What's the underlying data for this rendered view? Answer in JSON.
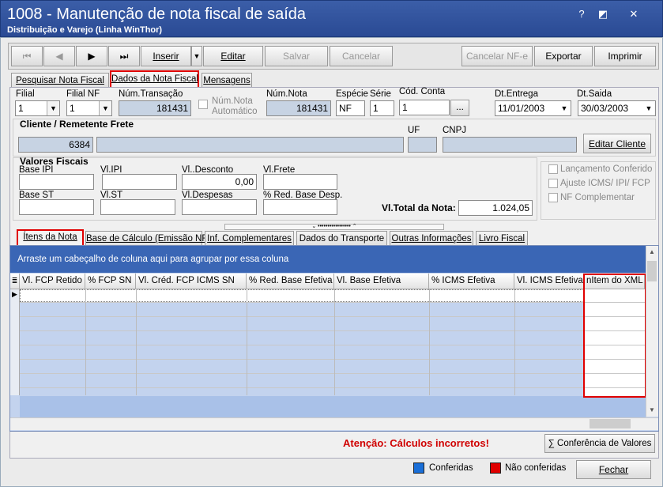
{
  "window": {
    "title": "1008 - Manutenção de nota fiscal de saída",
    "subtitle": "Distribuição e Varejo (Linha WinThor)",
    "buttons": [
      "?",
      "◩",
      "✕"
    ]
  },
  "toolbar": {
    "first": "⏮",
    "prev": "◀",
    "next": "▶",
    "last": "⏭",
    "inserir": "Inserir",
    "editar": "Editar",
    "salvar": "Salvar",
    "cancelar": "Cancelar",
    "cancelar_nfe": "Cancelar NF-e",
    "exportar": "Exportar",
    "imprimir": "Imprimir"
  },
  "tabs": [
    "Pesquisar Nota Fiscal",
    "Dados da Nota Fiscal",
    "Mensagens"
  ],
  "form": {
    "filial_label": "Filial",
    "filial_value": "1",
    "filial_nf_label": "Filial NF",
    "filial_nf_value": "1",
    "num_transacao_label": "Núm.Transação",
    "num_transacao_value": "181431",
    "num_nota_auto_label": "Núm.Nota Automático",
    "num_nota_label": "Núm.Nota",
    "num_nota_value": "181431",
    "especie_label": "Espécie",
    "especie_value": "NF",
    "serie_label": "Série",
    "serie_value": "1",
    "cod_conta_label": "Cód. Conta",
    "cod_conta_value": "1",
    "cod_conta_btn": "...",
    "dt_entrega_label": "Dt.Entrega",
    "dt_entrega_value": "11/01/2003",
    "dt_saida_label": "Dt.Saida",
    "dt_saida_value": "30/03/2003"
  },
  "cliente": {
    "section_label": "Cliente / Remetente Frete",
    "code": "6384",
    "name": "",
    "uf_label": "UF",
    "cnpj_label": "CNPJ",
    "edit_button": "Editar Cliente"
  },
  "valores": {
    "section_label": "Valores Fiscais",
    "base_ipi_label": "Base IPI",
    "base_ipi": "",
    "vl_ipi_label": "Vl.IPI",
    "vl_ipi": "",
    "vl_desconto_label": "Vl..Desconto",
    "vl_desconto": "0,00",
    "vl_frete_label": "Vl.Frete",
    "vl_frete": "",
    "base_st_label": "Base ST",
    "base_st": "",
    "vl_st_label": "Vl.ST",
    "vl_st": "",
    "vl_despesas_label": "Vl.Despesas",
    "vl_despesas": "",
    "red_base_label": "% Red. Base Desp.",
    "red_base": "",
    "total_label": "Vl.Total da Nota:",
    "total_value": "1.024,05"
  },
  "checkboxes": [
    "Lançamento Conferido",
    "Ajuste ICMS/ IPI/ FCP",
    "NF Complementar"
  ],
  "subtabs": [
    "Ítens da Nota",
    "Base de Cálculo (Emissão NF)",
    "Inf. Complementares",
    "Dados do Transporte",
    "Outras Informações",
    "Livro Fiscal"
  ],
  "grid": {
    "group_hint": "Arraste um cabeçalho de coluna aqui para agrupar por essa coluna",
    "columns": [
      "Vl. FCP Retido",
      "% FCP SN",
      "Vl. Créd. FCP ICMS SN",
      "% Red. Base Efetiva",
      "Vl. Base Efetiva",
      "% ICMS Efetiva",
      "Vl. ICMS Efetiva",
      "nItem do XML"
    ],
    "row_indicator": "▶"
  },
  "footer": {
    "warning": "Atenção: Cálculos incorretos!",
    "conferencia_button": "Conferência de Valores",
    "legend_conferidas": "Conferidas",
    "legend_nao_conferidas": "Não conferidas",
    "fechar_button": "Fechar"
  },
  "colors": {
    "conferidas": "#1a6fd8",
    "nao_conferidas": "#e00000",
    "grid_blue": "#3a66b5",
    "warning": "#d00000"
  }
}
